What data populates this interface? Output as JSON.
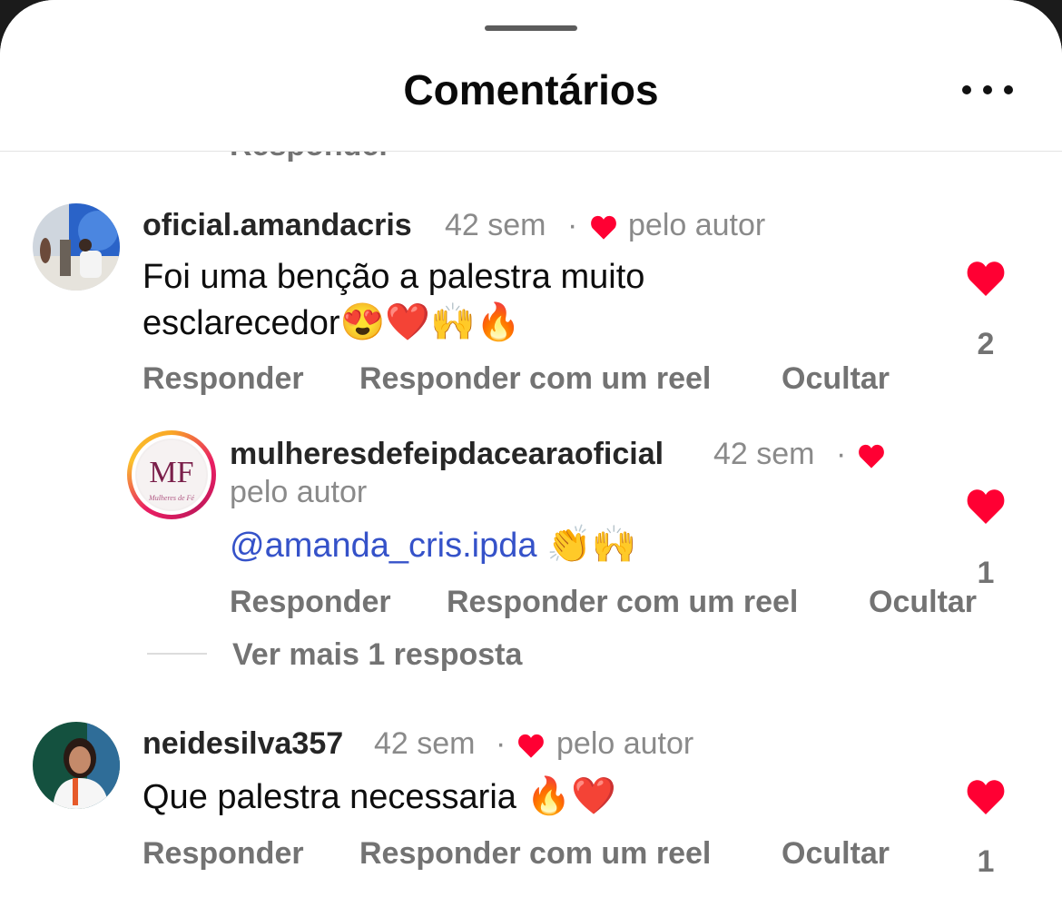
{
  "header": {
    "title": "Comentários"
  },
  "clipped_previous_reply": "Responder",
  "comments": [
    {
      "username": "oficial.amandacris",
      "time": "42 sem",
      "separator": "·",
      "author_like": "pelo autor",
      "text_line1": "Foi uma benção a palestra muito",
      "text_line2": "esclarecedor",
      "emojis": "😍❤️🙌🔥",
      "likes": "2",
      "actions": {
        "reply": "Responder",
        "reply_reel": "Responder com um reel",
        "hide": "Ocultar"
      }
    },
    {
      "username": "mulheresdefeipdacearaoficial",
      "time": "42 sem",
      "separator": "·",
      "author_like": "pelo autor",
      "mention": "@amanda_cris.ipda",
      "emojis": "👏🙌",
      "likes": "1",
      "avatar_text": "Mulheres de Fé",
      "actions": {
        "reply": "Responder",
        "reply_reel": "Responder com um reel",
        "hide": "Ocultar"
      }
    },
    {
      "username": "neidesilva357",
      "time": "42 sem",
      "separator": "·",
      "author_like": "pelo autor",
      "text": "Que palestra necessaria ",
      "emojis": "🔥❤️",
      "likes": "1",
      "actions": {
        "reply": "Responder",
        "reply_reel": "Responder com um reel",
        "hide": "Ocultar"
      }
    }
  ],
  "view_more_replies": "Ver mais 1 resposta",
  "colors": {
    "heart": "#ff0033",
    "mention": "#3552c9",
    "muted": "#737373"
  }
}
